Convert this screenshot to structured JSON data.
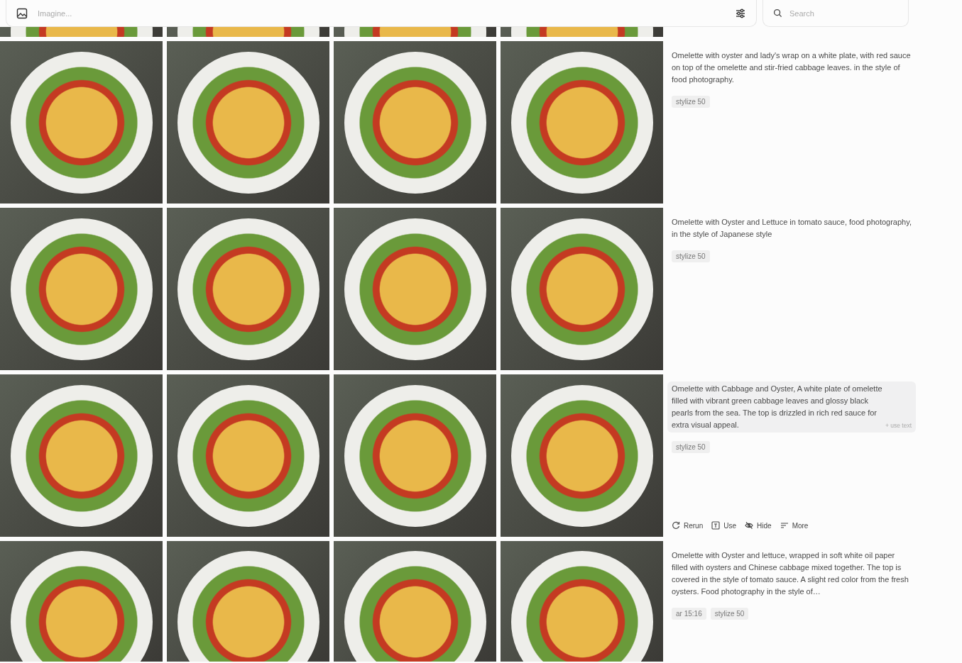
{
  "prompt_bar": {
    "placeholder": "Imagine..."
  },
  "search": {
    "placeholder": "Search"
  },
  "rows": [
    {},
    {
      "prompt": "Omelette with oyster and lady's wrap on a white plate, with red sauce on top of the omelette and stir-fried cabbage leaves. in the style of food photography.",
      "highlighted": false,
      "tags": [
        "stylize 50"
      ]
    },
    {
      "prompt": "Omelette with Oyster and Lettuce in tomato sauce, food photography, in the style of Japanese style",
      "highlighted": false,
      "tags": [
        "stylize 50"
      ]
    },
    {
      "prompt": "Omelette with Cabbage and Oyster, A white plate of omelette filled with vibrant green cabbage leaves and glossy black pearls from the sea. The top is drizzled in rich red sauce for extra visual appeal.",
      "highlighted": true,
      "use_text": "+ use text",
      "tags": [
        "stylize 50"
      ],
      "actions": [
        {
          "kind": "rerun",
          "label": "Rerun"
        },
        {
          "kind": "use",
          "label": "Use"
        },
        {
          "kind": "hide",
          "label": "Hide"
        },
        {
          "kind": "more",
          "label": "More"
        }
      ]
    },
    {
      "prompt": "Omelette with Oyster and lettuce, wrapped in soft white oil paper filled with oysters and Chinese cabbage mixed together. The top is covered in the style of tomato sauce. A slight red color from the fresh oysters. Food photography in the style of…",
      "highlighted": false,
      "tags": [
        "ar 15:16",
        "stylize 50"
      ]
    }
  ]
}
